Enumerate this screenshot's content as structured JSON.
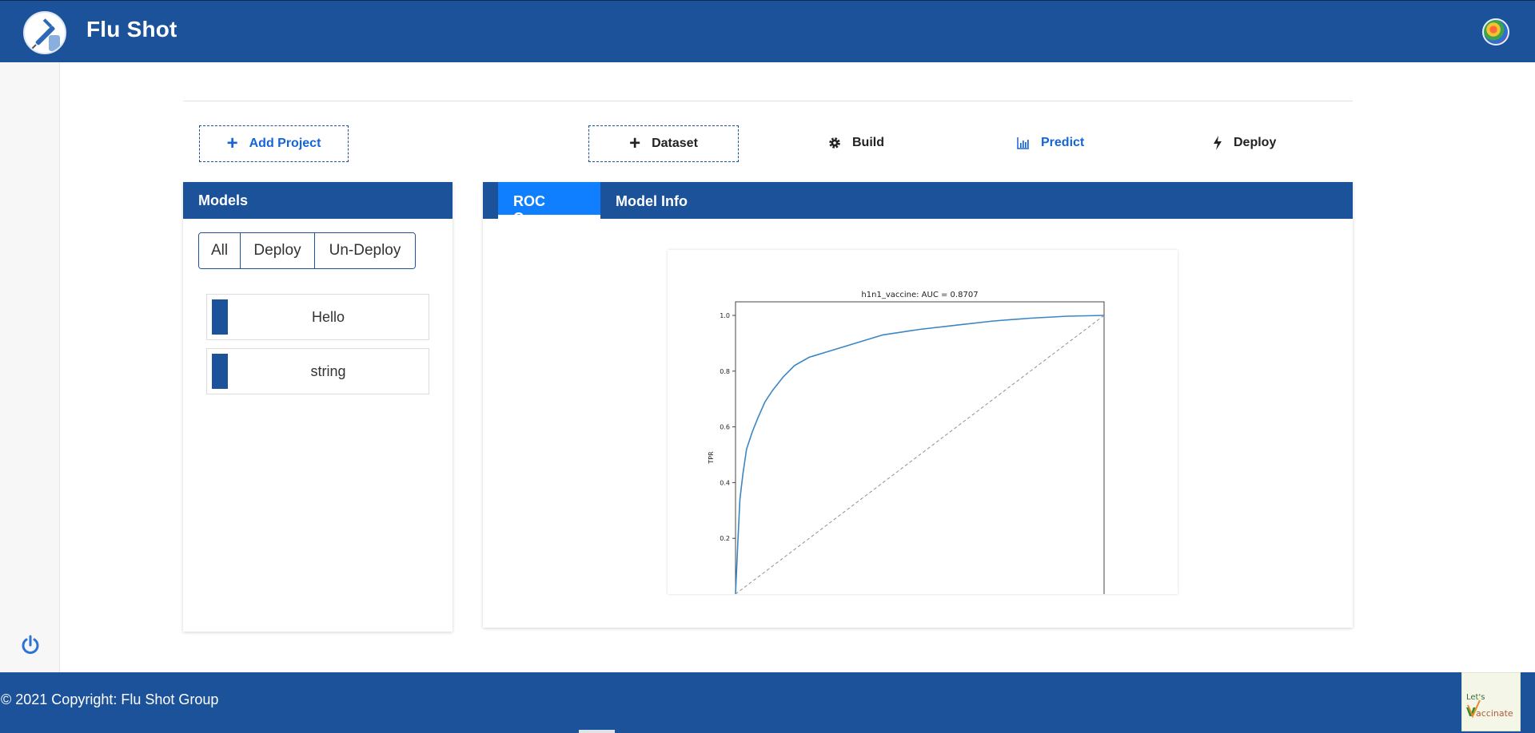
{
  "header": {
    "app_title": "Flu Shot",
    "logo_icon": "syringe-vaccine-icon",
    "avatar_icon": "colorful-user-avatar-icon"
  },
  "toolbar": {
    "add_project_label": "Add Project",
    "dataset_label": "Dataset",
    "build_label": "Build",
    "predict_label": "Predict",
    "deploy_label": "Deploy",
    "active_step": "Predict"
  },
  "models_panel": {
    "title": "Models",
    "filters": [
      "All",
      "Deploy",
      "Un-Deploy"
    ],
    "items": [
      {
        "label": "Hello"
      },
      {
        "label": "string"
      }
    ]
  },
  "tabs": [
    {
      "label": "ROC Curve",
      "active": true
    },
    {
      "label": "Model Info",
      "active": false
    }
  ],
  "chart_data": {
    "type": "line",
    "title": "h1n1_vaccine: AUC = 0.8707",
    "xlabel": "",
    "ylabel": "TPR",
    "ylim": [
      0.0,
      1.0
    ],
    "xlim": [
      0.0,
      1.0
    ],
    "y_ticks": [
      "0.2",
      "0.4",
      "0.6",
      "0.8",
      "1.0"
    ],
    "grid": false,
    "series": [
      {
        "x": [
          0.0,
          0.006,
          0.012,
          0.02,
          0.03,
          0.045,
          0.06,
          0.08,
          0.1,
          0.13,
          0.16,
          0.2,
          0.25,
          0.3,
          0.35,
          0.4,
          0.5,
          0.6,
          0.7,
          0.8,
          0.9,
          1.0
        ],
        "y": [
          0.0,
          0.18,
          0.34,
          0.43,
          0.52,
          0.58,
          0.63,
          0.69,
          0.73,
          0.78,
          0.82,
          0.85,
          0.87,
          0.89,
          0.91,
          0.93,
          0.95,
          0.965,
          0.98,
          0.99,
          0.997,
          1.0
        ],
        "color": "#3a86c4"
      },
      {
        "x": [
          0.0,
          1.0
        ],
        "y": [
          0.0,
          1.0
        ],
        "color": "#8f8f8f",
        "style": "dashed"
      }
    ]
  },
  "footer": {
    "copyright": "© 2021 Copyright: Flu Shot Group",
    "badge_text": "Let's Vaccinate"
  },
  "colors": {
    "primary": "#1b5299",
    "active_tab": "#0f7fff",
    "link_blue": "#1565d8"
  }
}
